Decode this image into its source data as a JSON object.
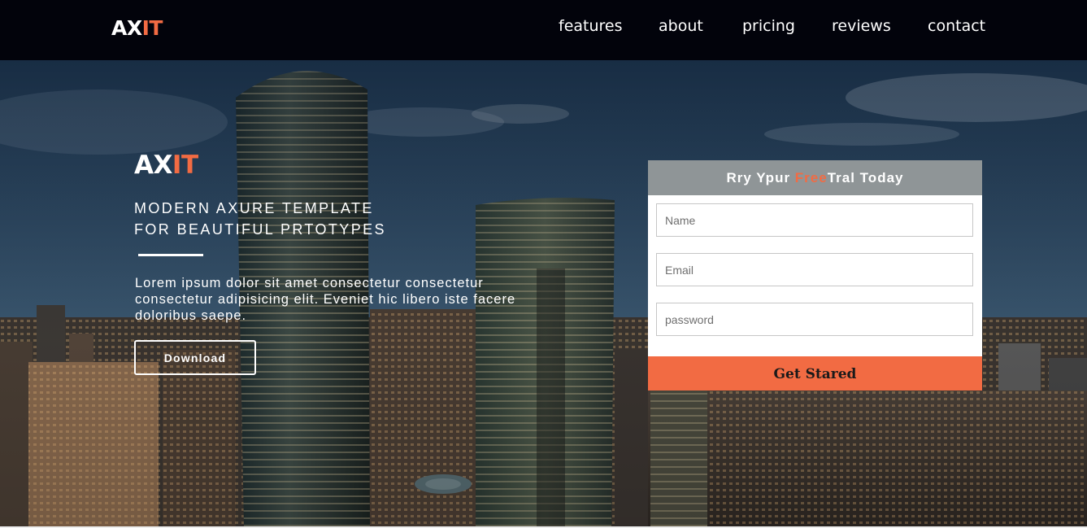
{
  "navbar": {
    "logo": {
      "part1": "AX",
      "part2": "IT"
    },
    "links": [
      "features",
      "about",
      "pricing",
      "reviews",
      "contact"
    ]
  },
  "hero": {
    "title": {
      "part1": "AX",
      "part2": "IT"
    },
    "subtitle_line1": "MODERN AXURE TEMPLATE",
    "subtitle_line2": "FOR BEAUTIFUL PRTOTYPES",
    "body_text": "Lorem ipsum dolor sit amet consectetur consectetur consectetur adipisicing elit. Eveniet hic libero iste facere doloribus saepe.",
    "download_label": "Download"
  },
  "signup_form": {
    "heading_before": "Rry Ypur ",
    "heading_highlight": "Free",
    "heading_after": "Tral Today",
    "name_placeholder": "Name",
    "email_placeholder": "Email",
    "password_placeholder": "password",
    "submit_label": "Get Stared"
  },
  "colors": {
    "accent": "#f26b43",
    "navbar_bg": "#02030b",
    "form_header_bg": "#8f9597"
  }
}
